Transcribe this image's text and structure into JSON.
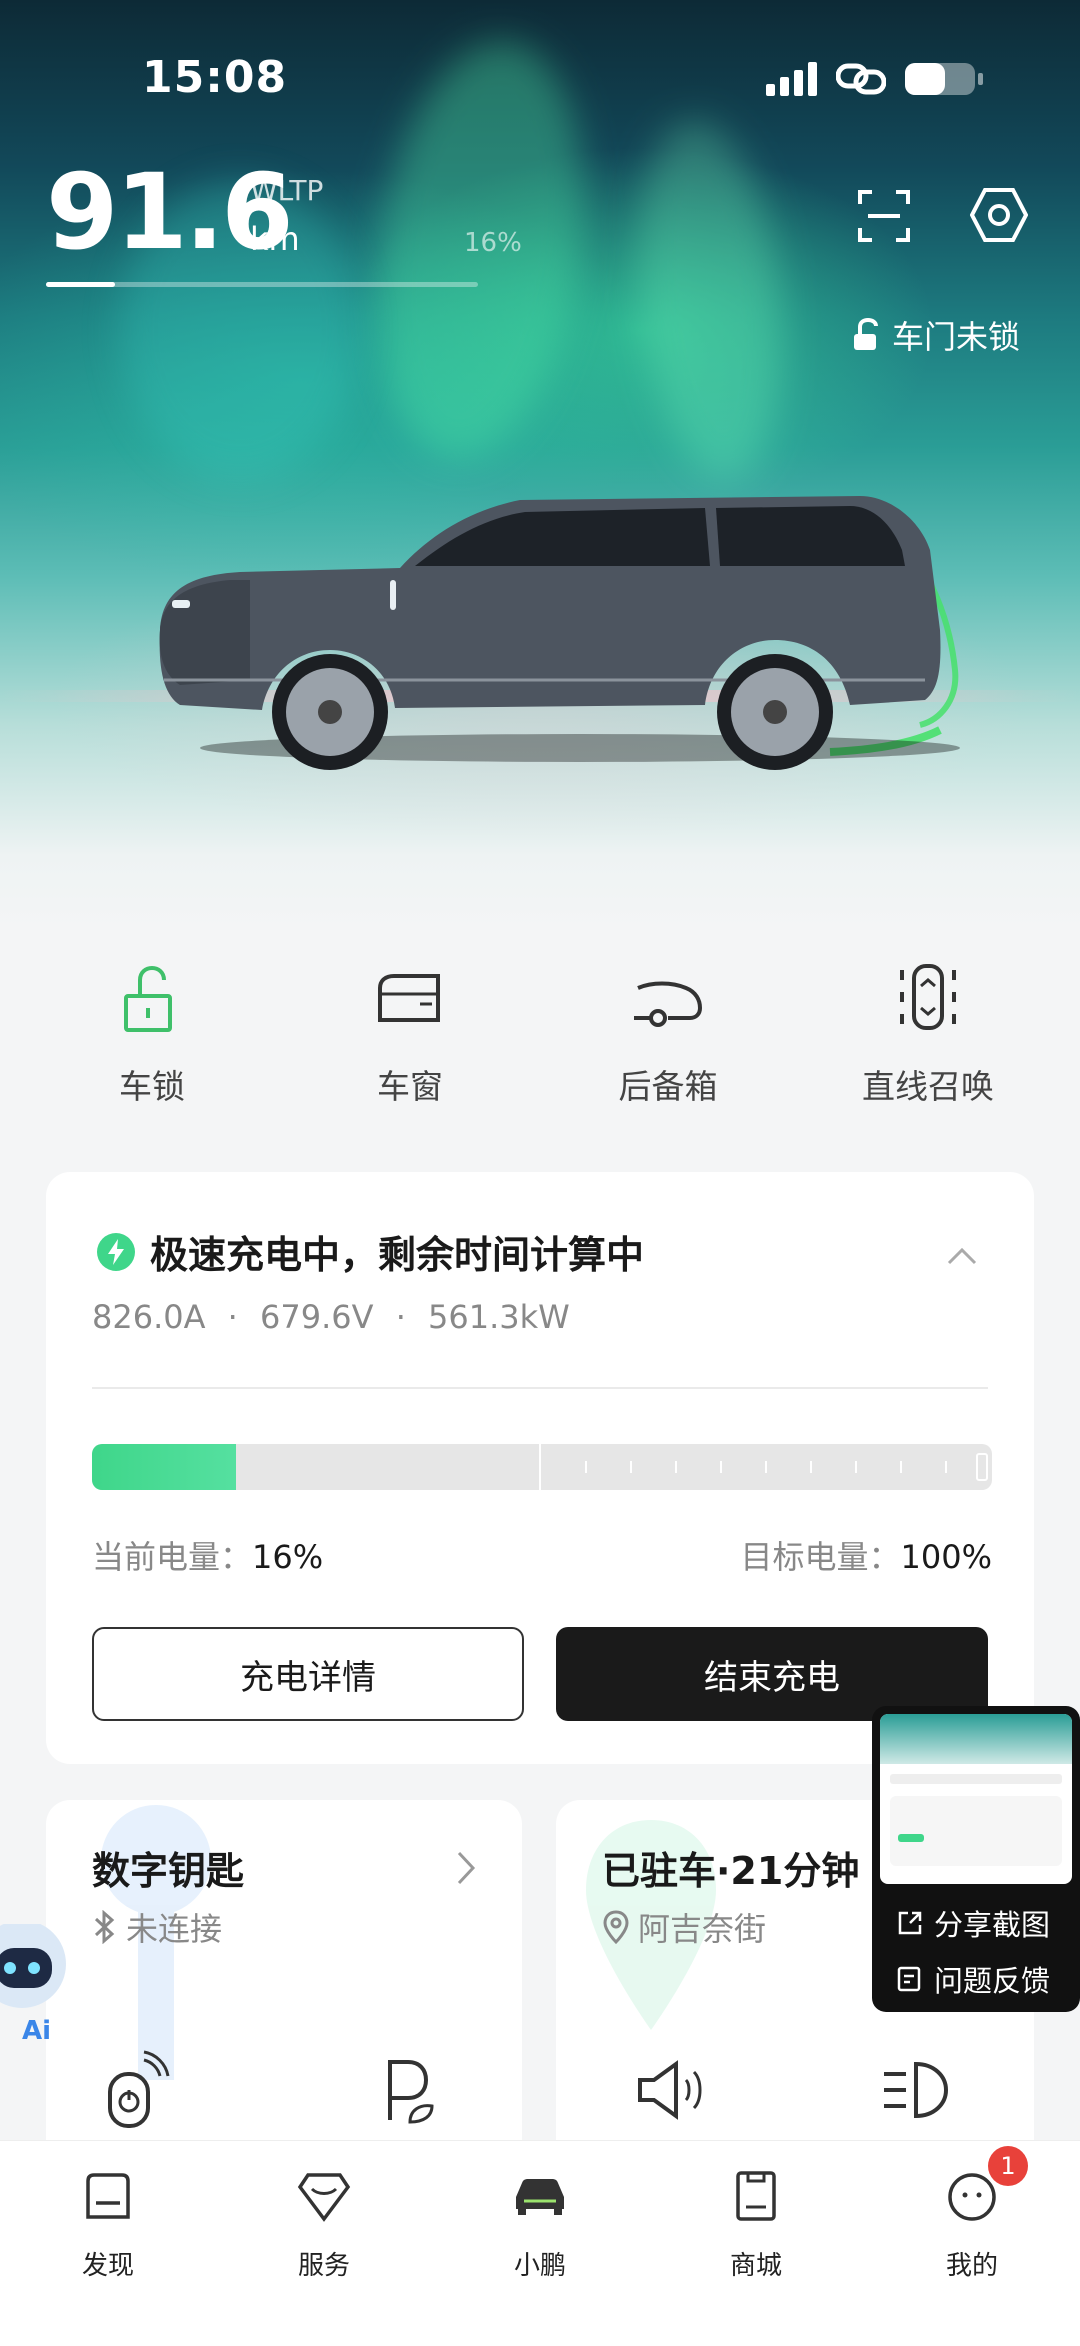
{
  "status_bar": {
    "time": "15:08"
  },
  "range": {
    "value": "91.6",
    "standard": "WLTP",
    "unit": "km",
    "battery_percent_label": "16%",
    "battery_fraction": 0.16
  },
  "door_status": "车门未锁",
  "quick_actions": [
    {
      "label": "车锁",
      "icon": "unlocked-padlock-icon"
    },
    {
      "label": "车窗",
      "icon": "car-window-icon"
    },
    {
      "label": "后备箱",
      "icon": "trunk-icon"
    },
    {
      "label": "直线召唤",
      "icon": "straight-summon-icon"
    }
  ],
  "charging": {
    "title": "极速充电中，剩余时间计算中",
    "current": "826.0A",
    "voltage": "679.6V",
    "power": "561.3kW",
    "separator": "·",
    "current_level_label": "当前电量：",
    "current_level": "16%",
    "target_level_label": "目标电量：",
    "target_level": "100%",
    "charge_fraction": 0.16,
    "detail_button": "充电详情",
    "stop_button": "结束充电",
    "accent_color": "#3fd68a"
  },
  "digital_key": {
    "title": "数字钥匙",
    "status": "未连接"
  },
  "parking": {
    "title": "已驻车·21分钟",
    "location": "阿吉奈街"
  },
  "popup": {
    "share_label": "分享截图",
    "feedback_label": "问题反馈"
  },
  "ai_label": "Ai",
  "tabs": [
    {
      "label": "发现",
      "icon": "discover-icon"
    },
    {
      "label": "服务",
      "icon": "service-icon"
    },
    {
      "label": "小鹏",
      "icon": "car-icon"
    },
    {
      "label": "商城",
      "icon": "mall-icon"
    },
    {
      "label": "我的",
      "icon": "profile-icon"
    }
  ],
  "profile_badge": "1"
}
